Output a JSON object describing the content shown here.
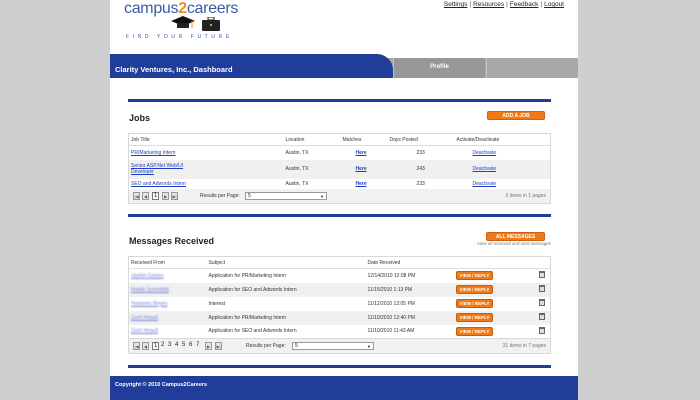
{
  "header": {
    "logo_word": "campus",
    "logo_two": "2",
    "logo_word2": "careers",
    "tagline": "FIND YOUR FUTURE",
    "links": [
      "Settings",
      "Resources",
      "Feedback",
      "Logout"
    ]
  },
  "nav": {
    "title": "Clarity Ventures, Inc., Dashboard",
    "profile_tab": "Profile"
  },
  "jobs": {
    "heading": "Jobs",
    "add_button": "ADD A JOB",
    "columns": [
      "Job Title",
      "Location",
      "Matches",
      "Days Posted",
      "Activate/Deactivate"
    ],
    "rows": [
      {
        "title": "PR/Marketing Intern",
        "location": "Austin, TX",
        "matches": "Here",
        "days": "233",
        "action": "Deactivate"
      },
      {
        "title": "Senior ASP.Net Web/UI Developer",
        "location": "Austin, TX",
        "matches": "Here",
        "days": "243",
        "action": "Deactivate"
      },
      {
        "title": "SEO and Adwords Intern",
        "location": "Austin, TX",
        "matches": "Here",
        "days": "233",
        "action": "Deactivate"
      }
    ],
    "pager": {
      "page": "1",
      "per_page_label": "Results per Page:",
      "per_page_value": "5",
      "info": "3 items in 1 pages"
    }
  },
  "messages": {
    "heading": "Messages Received",
    "all_button": "ALL MESSAGES",
    "all_sub": "View all received and sent messages",
    "columns": [
      "Received From",
      "Subject",
      "Date Received"
    ],
    "view_label": "VIEW / REPLY",
    "rows": [
      {
        "from": "Jaylish Gaines",
        "subject": "Application for PR/Marketing Intern",
        "date": "12/14/2010 12:08 PM"
      },
      {
        "from": "Noelle Schonfeld",
        "subject": "Application for SEO and Adwords Intern",
        "date": "11/15/2010 1:13 PM"
      },
      {
        "from": "Yasmeen Reyes",
        "subject": "Interest",
        "date": "11/12/2010 12:05 PM"
      },
      {
        "from": "Zach Heault",
        "subject": "Application for PR/Marketing Intern",
        "date": "11/10/2010 12:40 PM"
      },
      {
        "from": "Zach Heault",
        "subject": "Application for SEO and Adwords Intern",
        "date": "11/10/2010 11:43 AM"
      }
    ],
    "pager": {
      "pages": [
        "1",
        "2",
        "3",
        "4",
        "5",
        "6",
        "7"
      ],
      "per_page_label": "Results per Page:",
      "per_page_value": "5",
      "info": "31 items in 7 pages"
    }
  },
  "footer": {
    "text": "Copyright © 2010 Campus2Careers"
  },
  "colors": {
    "brand_blue": "#1f3d99",
    "accent_orange": "#f07b16"
  }
}
